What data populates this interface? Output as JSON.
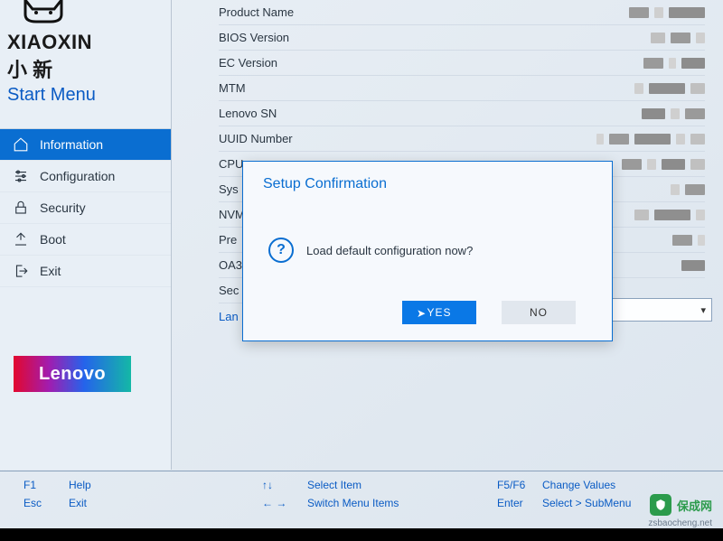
{
  "brand": {
    "line1": "XIAOXIN",
    "line2": "小 新",
    "menu": "Start Menu"
  },
  "sidebar": {
    "items": [
      {
        "label": "Information",
        "icon": "home-icon",
        "active": true
      },
      {
        "label": "Configuration",
        "icon": "sliders-icon",
        "active": false
      },
      {
        "label": "Security",
        "icon": "lock-icon",
        "active": false
      },
      {
        "label": "Boot",
        "icon": "boot-icon",
        "active": false
      },
      {
        "label": "Exit",
        "icon": "exit-icon",
        "active": false
      }
    ]
  },
  "lenovo": "Lenovo",
  "fields": [
    {
      "label": "Product Name"
    },
    {
      "label": "BIOS Version"
    },
    {
      "label": "EC Version"
    },
    {
      "label": "MTM"
    },
    {
      "label": "Lenovo SN"
    },
    {
      "label": "UUID Number"
    },
    {
      "label": "CPU"
    },
    {
      "label": "Sys"
    },
    {
      "label": "NVM"
    },
    {
      "label": "Pre"
    },
    {
      "label": "OA3"
    },
    {
      "label": "Sec"
    },
    {
      "label": "Lan"
    }
  ],
  "dialog": {
    "title": "Setup Confirmation",
    "message": "Load default configuration now?",
    "yes": "YES",
    "no": "NO"
  },
  "footer": {
    "r1c1k": "F1",
    "r1c1v": "Help",
    "r2c1k": "Esc",
    "r2c1v": "Exit",
    "r1c2k": "↑↓",
    "r1c2v": "Select Item",
    "r2c2k": "← →",
    "r2c2v": "Switch Menu Items",
    "r1c3k": "F5/F6",
    "r1c3v": "Change Values",
    "r2c3k": "Enter",
    "r2c3v": "Select > SubMenu"
  },
  "watermark": {
    "text": "保成网",
    "sub": "zsbaocheng.net"
  }
}
